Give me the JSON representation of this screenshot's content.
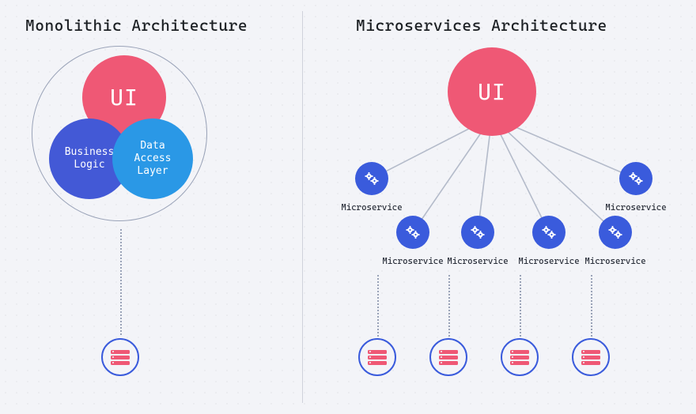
{
  "left": {
    "title": "Monolithic Architecture",
    "ui_label": "UI",
    "business_label": "Business\nLogic",
    "data_label": "Data\nAccess\nLayer"
  },
  "right": {
    "title": "Microservices Architecture",
    "ui_label": "UI",
    "ms_label": "Microservice"
  },
  "colors": {
    "ui": "#ef5875",
    "business": "#4359d6",
    "data": "#2a98e6",
    "node": "#3a5bdc",
    "line": "#b4bbca"
  }
}
